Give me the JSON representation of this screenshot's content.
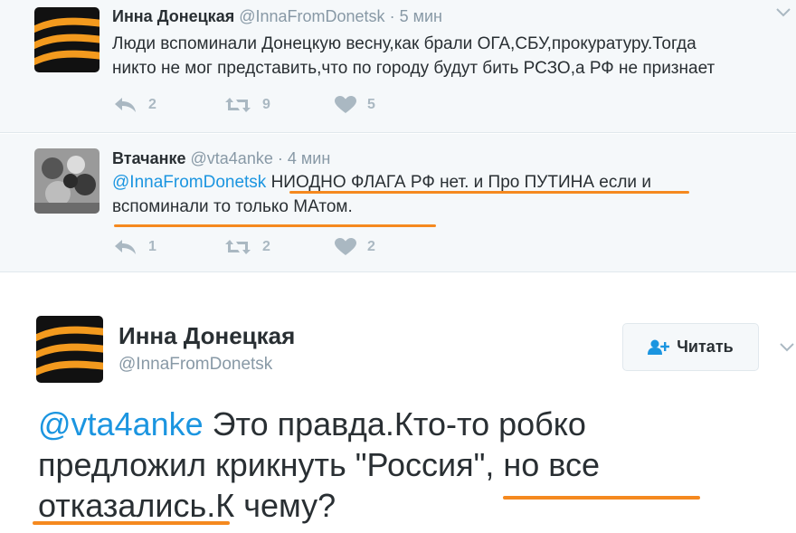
{
  "tweet1": {
    "name": "Инна Донецкая",
    "handle": "@InnaFromDonetsk",
    "sep": "·",
    "time": "5 мин",
    "line1": "Люди вспоминали Донецкую весну,как брали ОГА,СБУ,прокуратуру.Тогда",
    "line2": "никто не мог представить,что по городу будут бить РСЗО,а РФ не признает",
    "replies": "2",
    "retweets": "9",
    "likes": "5"
  },
  "tweet2": {
    "name": "Втачанке",
    "handle": "@vta4anke",
    "sep": "·",
    "time": "4 мин",
    "mention": "@InnaFromDonetsk",
    "line1_rest": " НИОДНО ФЛАГА РФ нет. и Про ПУТИНА если и",
    "line2": "вспоминали то только МАтом.",
    "replies": "1",
    "retweets": "2",
    "likes": "2"
  },
  "main": {
    "name": "Инна Донецкая",
    "handle": "@InnaFromDonetsk",
    "follow_label": "Читать",
    "mention": "@vta4anke",
    "line1_rest": " Это правда.Кто-то робко",
    "line2": "предложил крикнуть \"Россия\", но все",
    "line3": "отказались.К чему?"
  },
  "colors": {
    "accent": "#1b95e0",
    "underline": "#f5891f",
    "ribbon_orange": "#f39a1e",
    "ribbon_black": "#111111"
  }
}
